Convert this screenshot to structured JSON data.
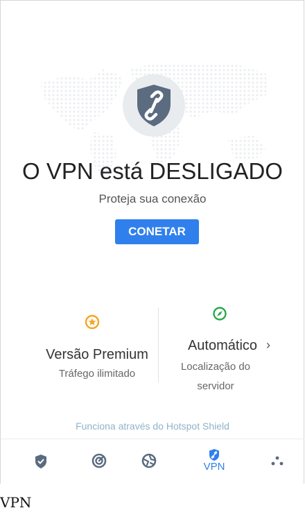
{
  "status": {
    "title": "O VPN está DESLIGADO",
    "subtitle": "Proteja sua conexão",
    "connect_label": "CONETAR"
  },
  "premium": {
    "title": "Versão Premium",
    "subtitle": "Tráfego ilimitado",
    "icon": "star-badge-icon"
  },
  "location": {
    "title": "Automático",
    "subtitle_line1": "Localização do",
    "subtitle_line2": "servidor",
    "icon": "compass-icon"
  },
  "footer": {
    "powered_by": "Funciona através do Hotspot Shield"
  },
  "nav": {
    "items": [
      {
        "icon": "shield-check-icon",
        "label": ""
      },
      {
        "icon": "speed-icon",
        "label": ""
      },
      {
        "icon": "web-icon",
        "label": ""
      },
      {
        "icon": "vpn-shield-icon",
        "label": "VPN"
      },
      {
        "icon": "more-dots-icon",
        "label": ""
      }
    ]
  },
  "caption": "VPN",
  "colors": {
    "accent": "#2f80ed",
    "premium": "#f5a623",
    "location": "#2ba84a",
    "shield": "#5b6b80"
  }
}
